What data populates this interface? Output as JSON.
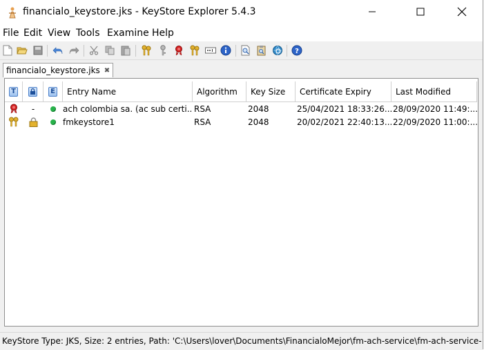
{
  "window": {
    "title": "financialo_keystore.jks - KeyStore Explorer 5.4.3"
  },
  "menu": [
    "File",
    "Edit",
    "View",
    "Tools",
    "Examine",
    "Help"
  ],
  "toolbar": {
    "icons": [
      "new-keystore-icon",
      "open-icon",
      "save-icon",
      "undo-icon",
      "redo-icon",
      "cut-icon",
      "copy-icon",
      "paste-icon",
      "generate-keypair-icon",
      "generate-secret-key-icon",
      "import-trusted-cert-icon",
      "import-keypair-icon",
      "set-password-icon",
      "properties-icon",
      "examine-file-icon",
      "examine-clipboard-icon",
      "examine-ssl-icon",
      "help-icon"
    ]
  },
  "tab": {
    "label": "financialo_keystore.jks",
    "close": "✖"
  },
  "table": {
    "columns": {
      "type": "T",
      "lock": "🔒",
      "expiry": "E",
      "entry_name": "Entry Name",
      "algorithm": "Algorithm",
      "key_size": "Key Size",
      "cert_expiry": "Certificate Expiry",
      "last_modified": "Last Modified"
    },
    "rows": [
      {
        "type_icon": "trusted-certificate-icon",
        "lock": "-",
        "status": "valid",
        "entry_name": "ach colombia sa. (ac sub certi...",
        "algorithm": "RSA",
        "key_size": "2048",
        "cert_expiry": "25/04/2021 18:33:26...",
        "last_modified": "28/09/2020 11:49:..."
      },
      {
        "type_icon": "key-pair-icon",
        "lock": "locked",
        "status": "valid",
        "entry_name": "fmkeystore1",
        "algorithm": "RSA",
        "key_size": "2048",
        "cert_expiry": "20/02/2021 22:40:13...",
        "last_modified": "22/09/2020 11:00:..."
      }
    ]
  },
  "status": {
    "text": "KeyStore Type: JKS, Size: 2 entries, Path: 'C:\\Users\\lover\\Documents\\FinancialoMejor\\fm-ach-service\\fm-ach-service-..."
  },
  "colors": {
    "valid_dot": "#27b24a",
    "header_icon_blue": "#4a7fc9",
    "cert_ribbon_red": "#d42020",
    "key_gold": "#d9a826"
  }
}
